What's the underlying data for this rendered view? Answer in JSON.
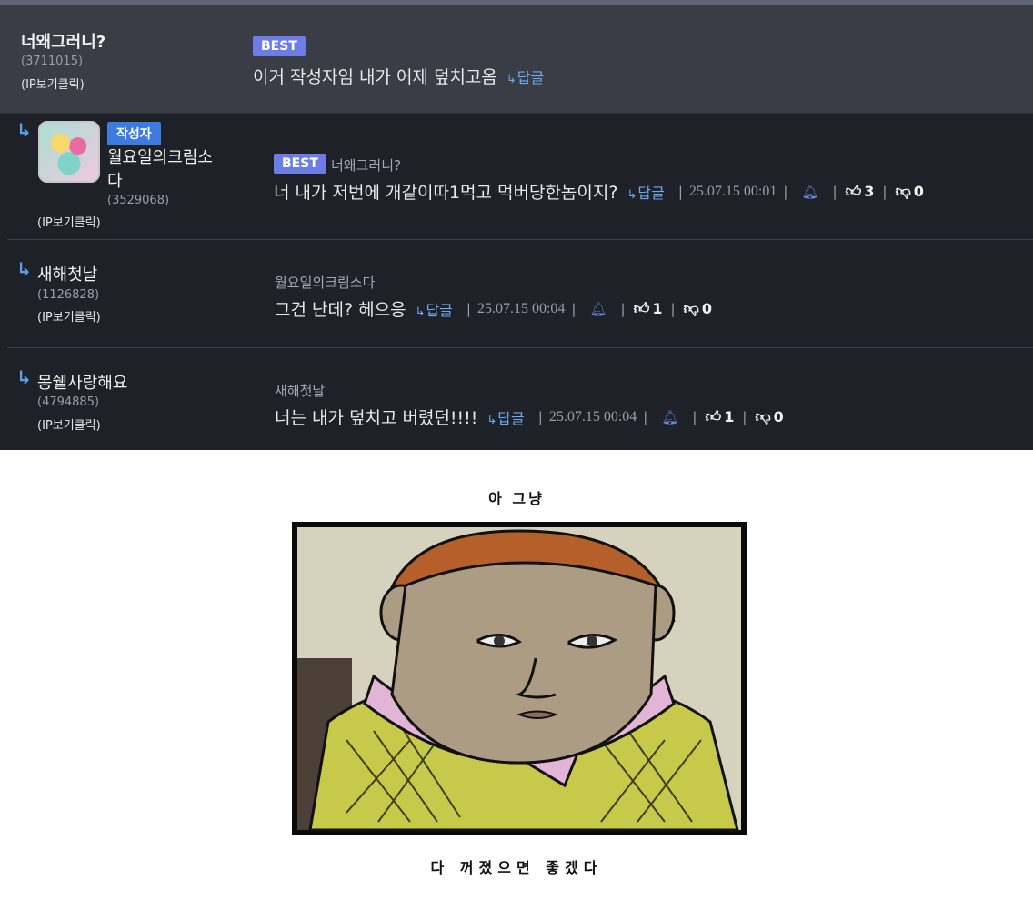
{
  "comments": [
    {
      "nickname": "너왜그러니?",
      "user_id": "(3711015)",
      "ip_label": "(IP보기클릭)",
      "best_label": "BEST",
      "text": "이거 작성자임 내가 어제 덮치고옴",
      "reply_label": "답글"
    },
    {
      "author_badge": "작성자",
      "nickname_line1": "월요일의크림소",
      "nickname_line2": "다",
      "user_id": "(3529068)",
      "ip_label": "(IP보기클릭)",
      "best_label": "BEST",
      "parent": "너왜그러니?",
      "text": "너 내가 저번에 개같이따1먹고 먹버당한놈이지?",
      "reply_label": "답글",
      "date": "25.07.15 00:01",
      "likes": "3",
      "dislikes": "0"
    },
    {
      "nickname": "새해첫날",
      "user_id": "(1126828)",
      "ip_label": "(IP보기클릭)",
      "parent": "월요일의크림소다",
      "text": "그건 난데? 헤으응",
      "reply_label": "답글",
      "date": "25.07.15 00:04",
      "likes": "1",
      "dislikes": "0"
    },
    {
      "nickname": "몽쉘사랑해요",
      "user_id": "(4794885)",
      "ip_label": "(IP보기클릭)",
      "parent": "새해첫날",
      "text": "너는 내가 덮치고 버렸던!!!!",
      "reply_label": "답글",
      "date": "25.07.15 00:04",
      "likes": "1",
      "dislikes": "0"
    }
  ],
  "cartoon": {
    "caption_top": "아 그냥",
    "caption_bottom": "다 꺼졌으면 좋겠다"
  }
}
